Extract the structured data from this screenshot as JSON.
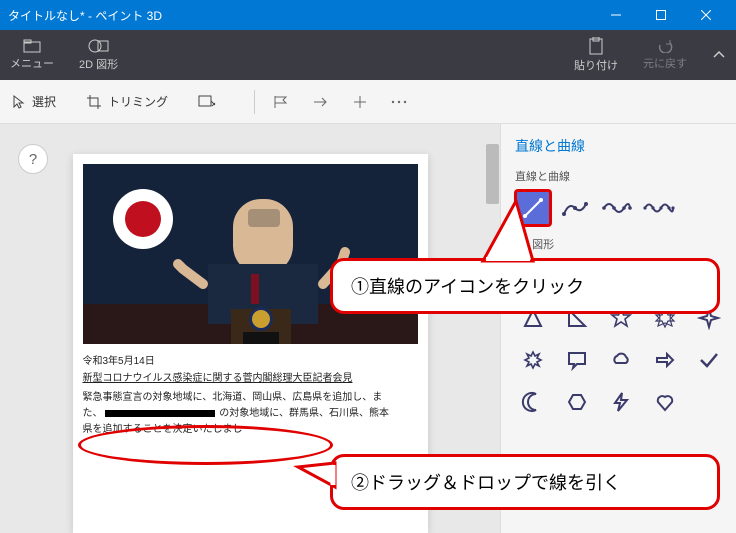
{
  "window": {
    "title": "タイトルなし* - ペイント 3D"
  },
  "ribbon": {
    "menu": "メニュー",
    "shapes2d": "2D 図形",
    "paste": "貼り付け",
    "undo": "元に戻す"
  },
  "toolbar": {
    "select": "選択",
    "trimming": "トリミング"
  },
  "sidebar": {
    "heading": "直線と曲線",
    "sectionLines": "直線と曲線",
    "section2d": "2D 図形"
  },
  "doc": {
    "date": "令和3年5月14日",
    "title": "新型コロナウイルス感染症に関する菅内閣総理大臣記者会見",
    "body1": "緊急事態宣言の対象地域に、北海道、岡山県、広島県を追加し、ま",
    "body2_pre": "た、",
    "body2_post": " の対象地域に、群馬県、石川県、熊本",
    "body3": "県を追加することを決定いたしまし"
  },
  "callouts": {
    "c1": "①直線のアイコンをクリック",
    "c2": "②ドラッグ＆ドロップで線を引く"
  },
  "help": "?"
}
